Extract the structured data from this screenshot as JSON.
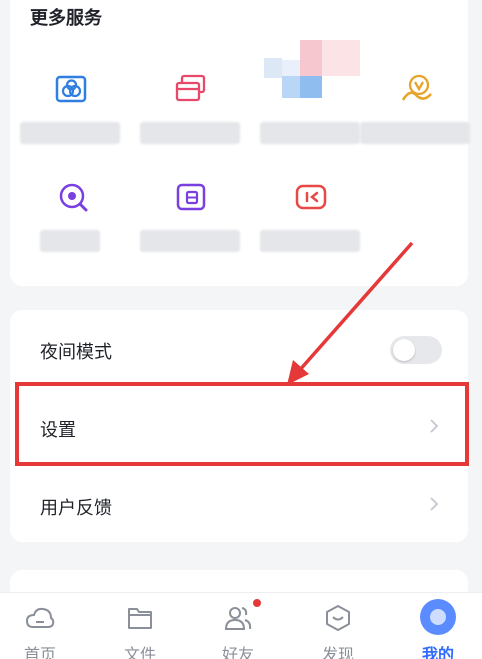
{
  "more_services": {
    "title": "更多服务",
    "items": [
      {
        "icon": "cloud-album-icon",
        "color": "#2f7fe0"
      },
      {
        "icon": "card-stack-icon",
        "color": "#e8486a"
      },
      {
        "icon": "mosaic-icon",
        "color": "#9fc6f2"
      },
      {
        "icon": "vip-crown-icon",
        "color": "#e8a32a"
      },
      {
        "icon": "search-scan-icon",
        "color": "#7a3fe0"
      },
      {
        "icon": "document-icon",
        "color": "#7a3fe0"
      },
      {
        "icon": "screen-record-icon",
        "color": "#e84848"
      }
    ]
  },
  "settings_list": {
    "night_mode": {
      "label": "夜间模式",
      "enabled": false
    },
    "settings": {
      "label": "设置"
    },
    "feedback": {
      "label": "用户反馈"
    }
  },
  "tabbar": {
    "tabs": [
      {
        "label": "首页",
        "icon": "cloud-icon"
      },
      {
        "label": "文件",
        "icon": "folder-icon"
      },
      {
        "label": "好友",
        "icon": "friends-icon",
        "badge": true
      },
      {
        "label": "发现",
        "icon": "discover-icon"
      },
      {
        "label": "我的",
        "icon": "profile-icon",
        "active": true
      }
    ]
  },
  "colors": {
    "accent": "#2f6bff",
    "highlight": "#e53838"
  }
}
